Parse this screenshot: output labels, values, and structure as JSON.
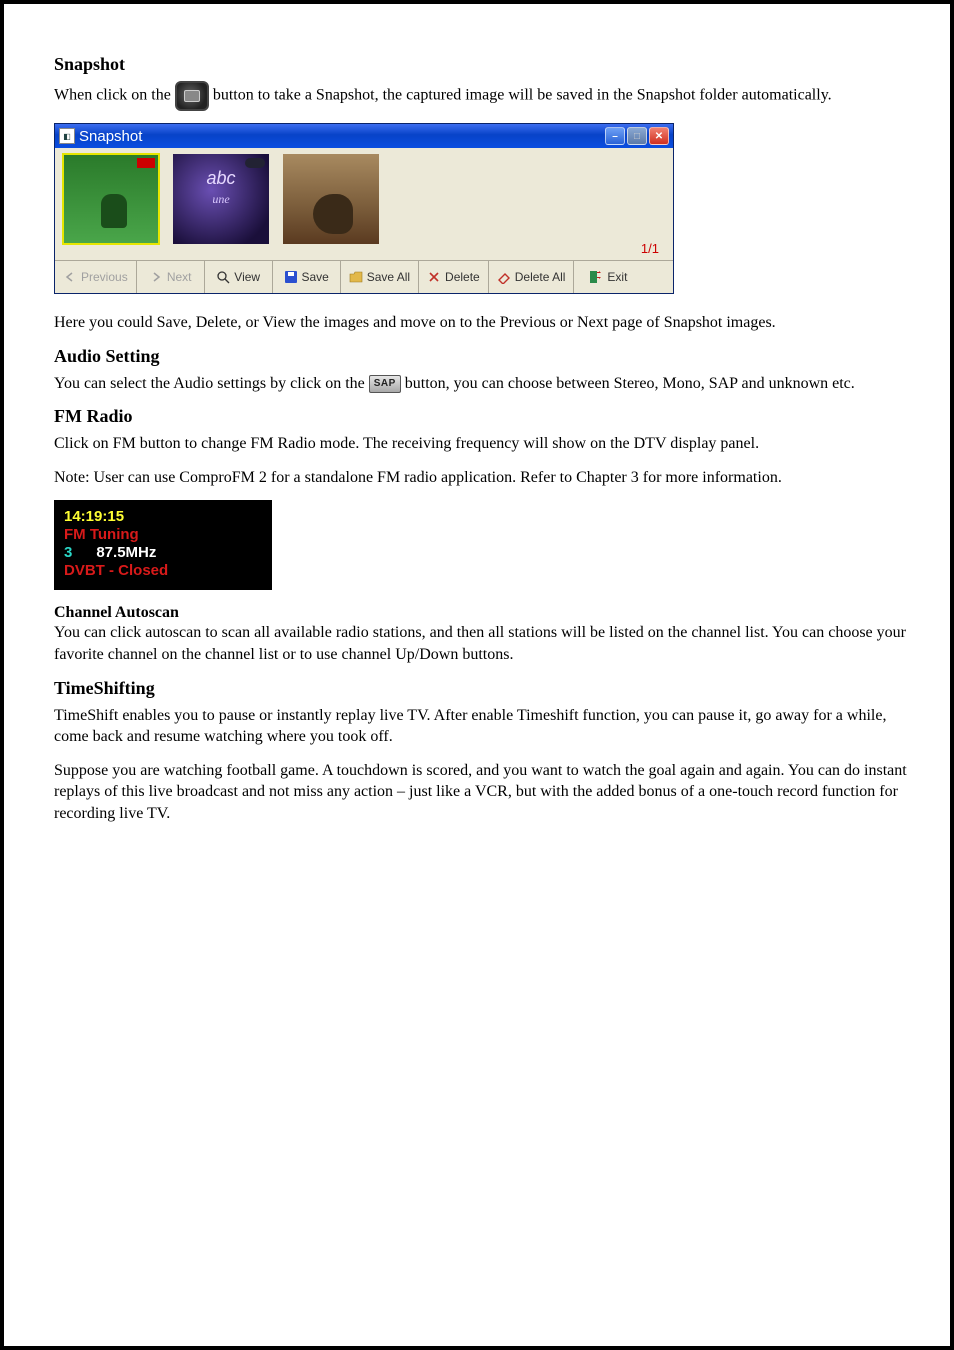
{
  "section_snapshot": {
    "heading": "Snapshot",
    "intro_prefix": "When click on the ",
    "intro_suffix": " button to take a Snapshot, the captured image will be saved in the Snapshot folder automatically.",
    "window": {
      "title": "Snapshot",
      "page_counter": "1/1",
      "toolbar": {
        "previous": "Previous",
        "next": "Next",
        "view": "View",
        "save": "Save",
        "save_all": "Save All",
        "delete": "Delete",
        "delete_all": "Delete All",
        "exit": "Exit"
      }
    },
    "closing": "Here you could Save, Delete, or View the images and move on to the Previous or Next page of Snapshot images."
  },
  "section_audio": {
    "heading": "Audio Setting",
    "text_before": "You can select the Audio settings by click on the ",
    "sap_label": "SAP",
    "text_after": " button, you can choose between Stereo, Mono, SAP and unknown etc."
  },
  "section_fm": {
    "heading": "FM Radio",
    "intro": "Click on FM button to change FM Radio mode. The receiving frequency will show on the DTV display panel.",
    "note": "Note: User can use ComproFM 2 for a standalone FM radio application. Refer to Chapter 3 for more information.",
    "display": {
      "time": "14:19:15",
      "tuning": "FM Tuning",
      "channel": "3",
      "freq": "87.5MHz",
      "status": "DVBT - Closed"
    },
    "sub_heading": "Channel Autoscan",
    "sub_text": "You can click autoscan to scan all available radio stations, and then all stations will be listed on the channel list. You can choose your favorite channel on the channel list or to use channel Up/Down buttons."
  },
  "section_timeshift": {
    "heading": "TimeShifting",
    "p1": "TimeShift enables you to pause or instantly replay live TV. After enable Timeshift function, you can pause it, go away for a while, come back and resume watching where you took off.",
    "p2": "Suppose you are watching football game. A touchdown is scored, and you want to watch the goal again and again. You can do instant replays of this live broadcast and not miss any action – just like a VCR, but with the added bonus of a one-touch record function for recording live TV."
  }
}
